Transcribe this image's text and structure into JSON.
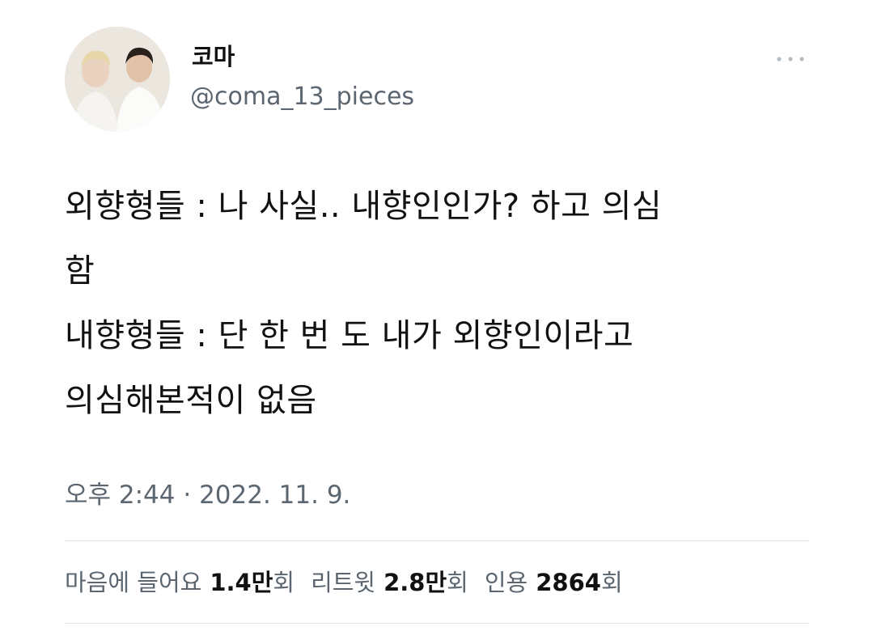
{
  "user": {
    "display_name": "코마",
    "handle": "@coma_13_pieces"
  },
  "tweet": {
    "lines": [
      "외향형들 : 나 사실.. 내향인인가? 하고 의심",
      "함",
      "내향형들 : 단 한 번 도 내가 외향인이라고",
      "의심해본적이 없음"
    ],
    "timestamp": "오후 2:44 · 2022. 11. 9."
  },
  "stats": {
    "likes": {
      "label": "마음에 들어요",
      "number": "1.4",
      "unit": "만",
      "suffix": "회"
    },
    "retweets": {
      "label": "리트윗",
      "number": "2.8",
      "unit": "만",
      "suffix": "회"
    },
    "quotes": {
      "label": "인용",
      "number": "2864",
      "unit": "",
      "suffix": "회"
    }
  },
  "icons": {
    "more": "more-horizontal-icon"
  }
}
